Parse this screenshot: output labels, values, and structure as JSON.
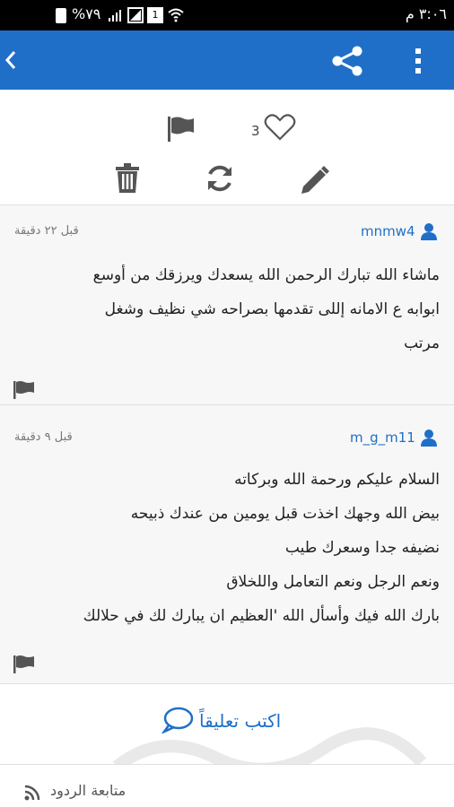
{
  "status_bar": {
    "time": "٣:٠٦ م",
    "battery": "%٧٩",
    "sim_badge": "1"
  },
  "app_bar": {
    "back_icon": "chevron-left-icon",
    "share_icon": "share-icon",
    "menu_icon": "overflow-menu-icon",
    "color": "#1f6fc8"
  },
  "actions": {
    "likes_count": "3",
    "icons": [
      "flag-icon",
      "heart-icon",
      "trash-icon",
      "refresh-icon",
      "pencil-icon"
    ]
  },
  "comments": [
    {
      "username": "mnmw4",
      "time": "قبل ٢٢ دقيقة",
      "lines": [
        "ماشاء الله تبارك الرحمن الله يسعدك ويرزقك من أوسع",
        "ابوابه ع الامانه إللى تقدمها بصراحه شي نظيف وشغل",
        "مرتب"
      ]
    },
    {
      "username": "m_g_m11",
      "time": "قبل ٩ دقيقة",
      "lines": [
        "السلام عليكم ورحمة الله وبركاته",
        "بيض الله وجهك اخذت قبل يومين من عندك ذبيحه",
        "نضيفه جدا وسعرك طيب",
        "ونعم الرجل ونعم التعامل واللخلاق",
        "بارك الله فيك وأسأل الله 'العظيم ان يبارك لك في حلالك"
      ]
    }
  ],
  "write_comment": {
    "label": "اكتب تعليقاً"
  },
  "follow": {
    "label": "متابعة الردود"
  }
}
